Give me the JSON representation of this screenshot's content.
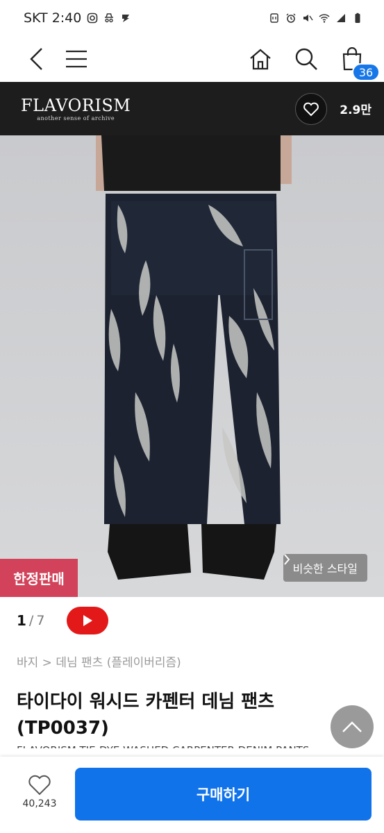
{
  "status_bar": {
    "carrier_time": "SKT 2:40"
  },
  "nav": {
    "cart_count": "36"
  },
  "brand": {
    "name": "FLAVORISM",
    "tagline": "another sense of archive",
    "like_count": "2.9만"
  },
  "hero": {
    "limited_label": "한정판매",
    "similar_label": "비슷한 스타일"
  },
  "pager": {
    "current": "1",
    "separator": "/",
    "total": "7"
  },
  "product": {
    "breadcrumb": "바지 > 데님 팬츠 (플레이버리즘)",
    "title": "타이다이 워시드 카펜터 데님 팬츠 (TP0037)",
    "subtitle": "FLAVORISM TIE-DYE WASHED CARPENTER DENIM PANTS"
  },
  "bottom": {
    "wish_count": "40,243",
    "buy_label": "구매하기"
  },
  "colors": {
    "accent": "#1173ea",
    "badge": "#d2425a",
    "youtube": "#e31919"
  }
}
